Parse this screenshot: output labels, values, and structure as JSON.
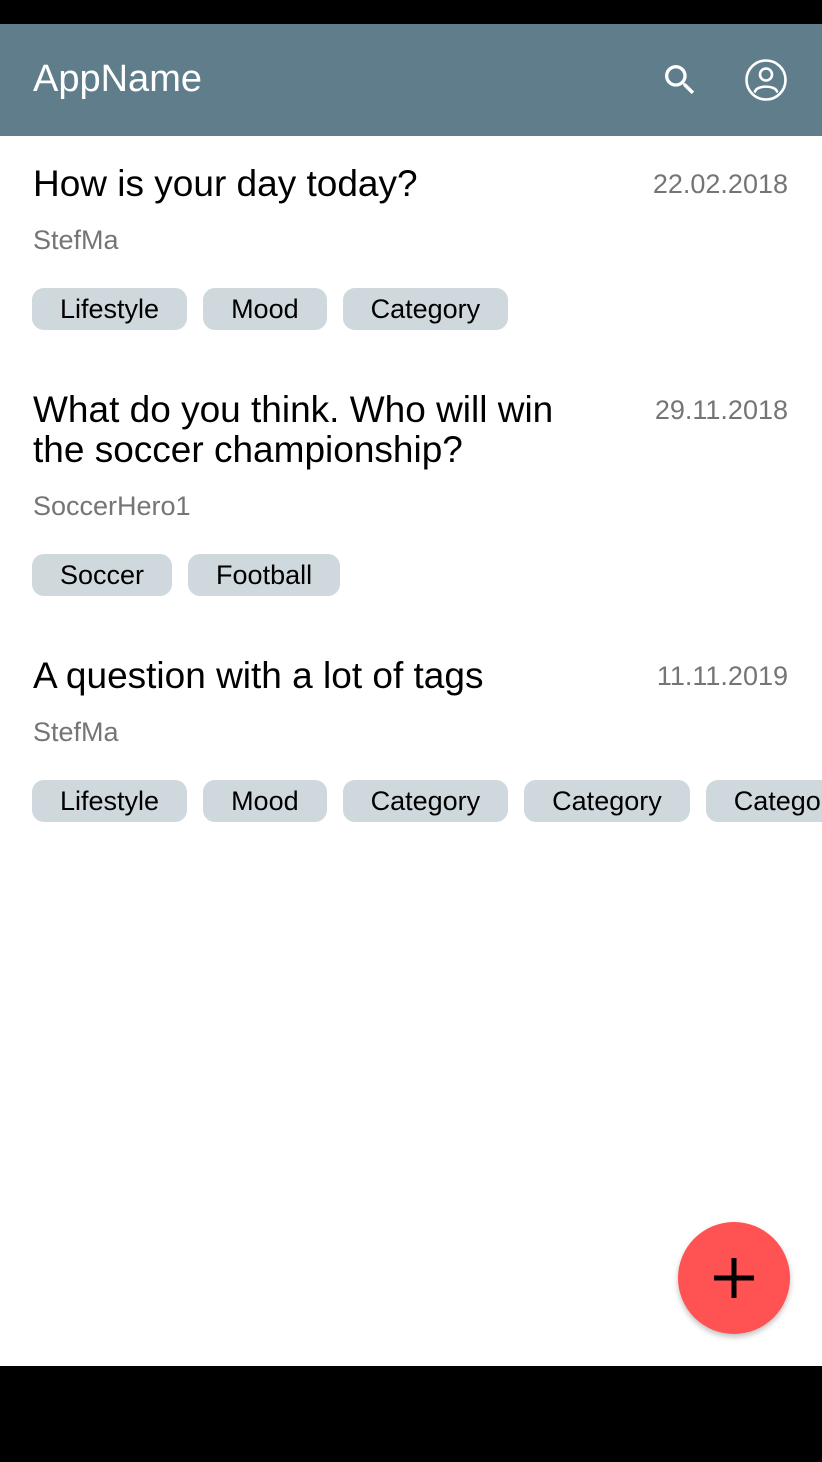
{
  "app_bar": {
    "title": "AppName",
    "actions": [
      {
        "icon": "search-icon"
      },
      {
        "icon": "account-circle-icon"
      }
    ],
    "background": "#607d8b"
  },
  "questions": [
    {
      "title": "How is your day today?",
      "author": "StefMa",
      "date": "22.02.2018",
      "tags": [
        "Lifestyle",
        "Mood",
        "Category"
      ]
    },
    {
      "title": "What do you think. Who will win the soccer championship?",
      "author": "SoccerHero1",
      "date": "29.11.2018",
      "tags": [
        "Soccer",
        "Football"
      ]
    },
    {
      "title": "A question with a lot of tags",
      "author": "StefMa",
      "date": "11.11.2019",
      "tags": [
        "Lifestyle",
        "Mood",
        "Category",
        "Category",
        "Category"
      ]
    }
  ],
  "fab": {
    "icon": "plus-icon",
    "color": "#ff5252"
  },
  "colors": {
    "tag_background": "#cfd8dc",
    "secondary_text": "#757575"
  }
}
